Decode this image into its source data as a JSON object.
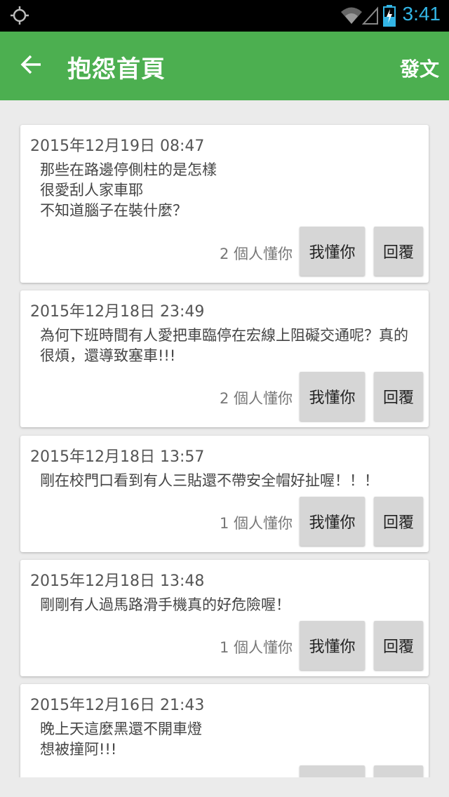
{
  "status_bar": {
    "time": "3:41",
    "icons": [
      "gps-icon",
      "wifi-icon",
      "signal-icon",
      "battery-charging-icon"
    ],
    "accent_color": "#33b5e5"
  },
  "app_bar": {
    "title": "抱怨首頁",
    "action_label": "發文",
    "color": "#4caf50"
  },
  "posts": [
    {
      "date": "2015年12月19日 08:47",
      "body": "那些在路邊停側柱的是怎樣\n很愛刮人家車耶\n不知道腦子在裝什麼？",
      "count_label": "2 個人懂你",
      "understand_label": "我懂你",
      "reply_label": "回覆"
    },
    {
      "date": "2015年12月18日 23:49",
      "body": "為何下班時間有人愛把車臨停在宏線上阻礙交通呢？真的很煩，還導致塞車!!!",
      "count_label": "2 個人懂你",
      "understand_label": "我懂你",
      "reply_label": "回覆"
    },
    {
      "date": "2015年12月18日 13:57",
      "body": "剛在校門口看到有人三貼還不帶安全帽好扯喔！！！",
      "count_label": "1 個人懂你",
      "understand_label": "我懂你",
      "reply_label": "回覆"
    },
    {
      "date": "2015年12月18日 13:48",
      "body": "剛剛有人過馬路滑手機真的好危險喔！",
      "count_label": "1 個人懂你",
      "understand_label": "我懂你",
      "reply_label": "回覆"
    },
    {
      "date": "2015年12月16日 21:43",
      "body": "晚上天這麼黑還不開車燈\n想被撞阿!!!",
      "count_label": "",
      "understand_label": "",
      "reply_label": ""
    }
  ]
}
